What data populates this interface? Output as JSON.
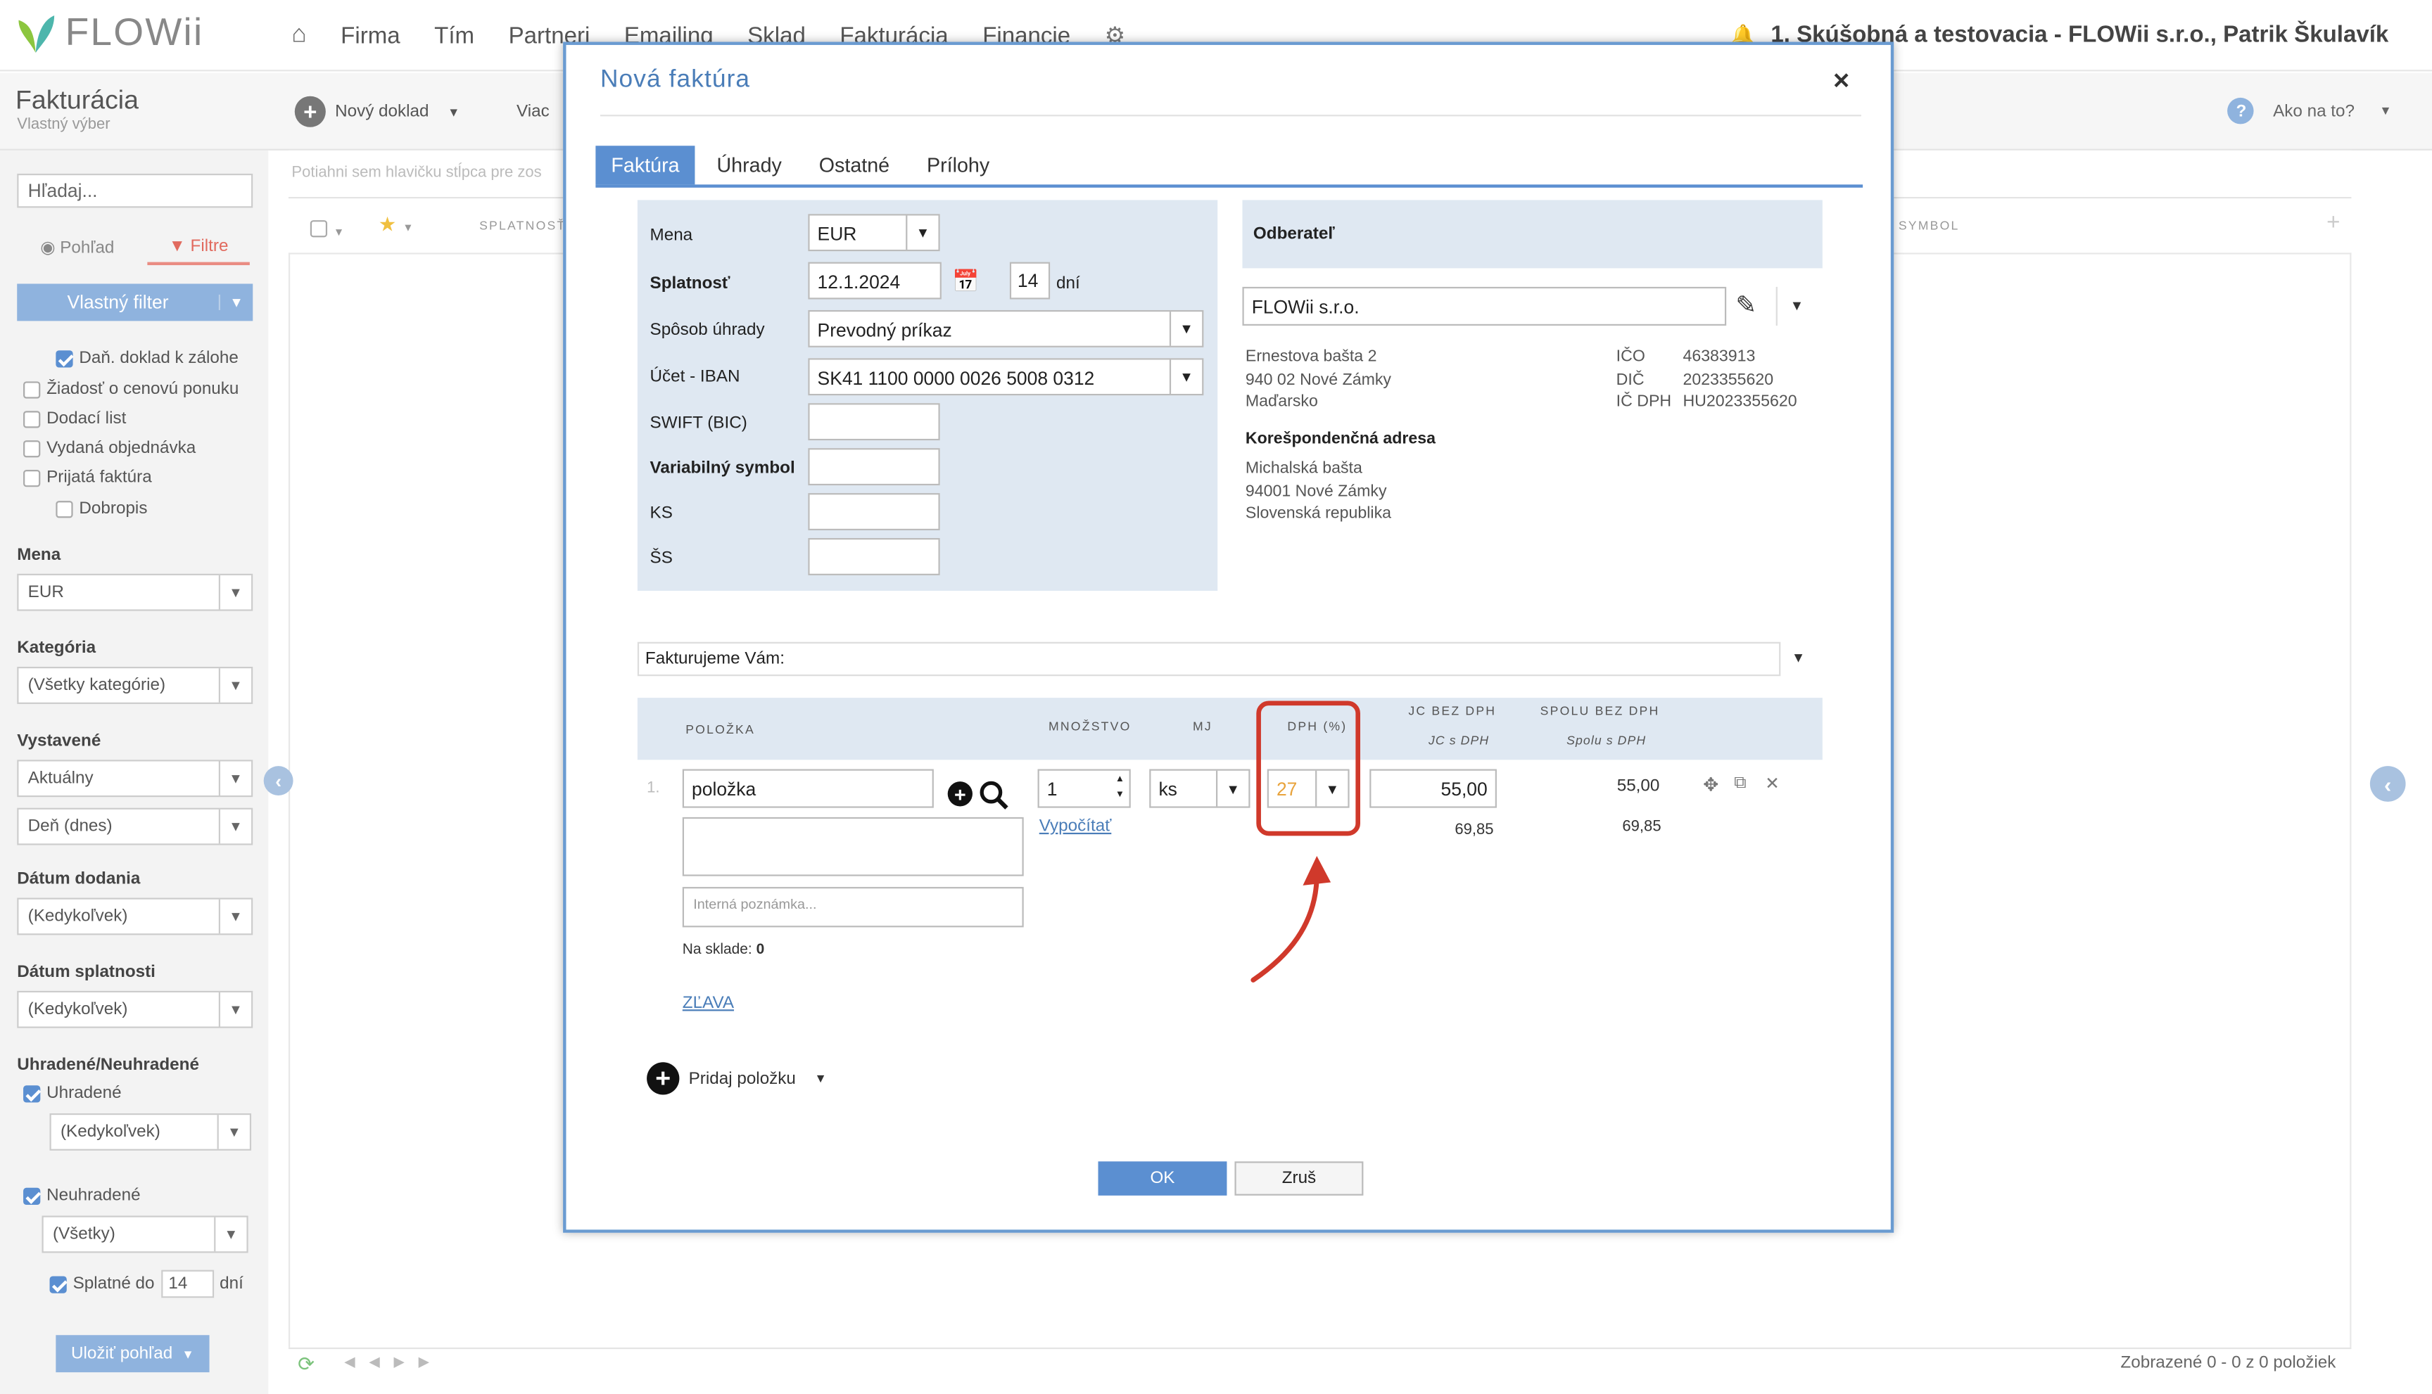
{
  "app": {
    "name": "FLOWii"
  },
  "nav": {
    "items": [
      "Firma",
      "Tím",
      "Partneri",
      "Emailing",
      "Sklad",
      "Fakturácia",
      "Financie"
    ],
    "company": "1. Skúšobná a testovacia - FLOWii s.r.o., Patrik Škulavík"
  },
  "page": {
    "title": "Fakturácia",
    "subtitle": "Vlastný výber",
    "new_doc": "Nový doklad",
    "more": "Viac",
    "help": "Ako na to?",
    "group_hint": "Potiahni sem hlavičku stĺpca pre zos",
    "col_due": "SPLATNOSŤ",
    "col_symbol": "SYMBOL",
    "footer_status": "Zobrazené 0 - 0 z 0 položiek"
  },
  "sidebar": {
    "search_placeholder": "Hľadaj...",
    "view_label": "Pohľad",
    "filter_label": "Filtre",
    "custom_filter": "Vlastný filter",
    "doc_types": [
      {
        "label": "Daň. doklad k zálohe",
        "checked": true
      },
      {
        "label": "Žiadosť o cenovú ponuku",
        "checked": false
      },
      {
        "label": "Dodací list",
        "checked": false
      },
      {
        "label": "Vydaná objednávka",
        "checked": false
      },
      {
        "label": "Prijatá faktúra",
        "checked": false
      },
      {
        "label": "Dobropis",
        "checked": false
      }
    ],
    "currency_label": "Mena",
    "currency_value": "EUR",
    "category_label": "Kategória",
    "category_value": "(Všetky kategórie)",
    "issued_label": "Vystavené",
    "issued_value": "Aktuálny",
    "issued_day": "Deň (dnes)",
    "delivery_label": "Dátum dodania",
    "delivery_value": "(Kedykoľvek)",
    "due_label": "Dátum splatnosti",
    "due_value": "(Kedykoľvek)",
    "paid_label": "Uhradené/Neuhradené",
    "paid": "Uhradené",
    "paid_value": "(Kedykoľvek)",
    "unpaid": "Neuhradené",
    "unpaid_value": "(Všetky)",
    "payable_label": "Splatné do",
    "payable_days": "14",
    "payable_unit": "dní",
    "save_view": "Uložiť pohľad"
  },
  "modal": {
    "title": "Nová faktúra",
    "tabs": [
      "Faktúra",
      "Úhrady",
      "Ostatné",
      "Prílohy"
    ],
    "form": {
      "currency_label": "Mena",
      "currency": "EUR",
      "due_label": "Splatnosť",
      "due_date": "12.1.2024",
      "due_days": "14",
      "due_unit": "dní",
      "payment_label": "Spôsob úhrady",
      "payment": "Prevodný príkaz",
      "iban_label": "Účet - IBAN",
      "iban": "SK41 1100 0000 0026 5008 0312",
      "swift_label": "SWIFT (BIC)",
      "vs_label": "Variabilný symbol",
      "ks_label": "KS",
      "ss_label": "ŠS"
    },
    "customer": {
      "header": "Odberateľ",
      "name": "FLOWii s.r.o.",
      "address": [
        "Ernestova bašta 2",
        "940 02 Nové Zámky",
        "Maďarsko"
      ],
      "ids": [
        {
          "k": "IČO",
          "v": "46383913"
        },
        {
          "k": "DIČ",
          "v": "2023355620"
        },
        {
          "k": "IČ DPH",
          "v": "HU2023355620"
        }
      ],
      "corr_header": "Korešpondenčná adresa",
      "corr_address": [
        "Michalská bašta",
        "94001 Nové Zámky",
        "Slovenská republika"
      ]
    },
    "intro": "Fakturujeme Vám:",
    "items_head": {
      "item": "POLOŽKA",
      "qty": "MNOŽSTVO",
      "unit": "MJ",
      "vat": "DPH (%)",
      "unit_price": "JC BEZ DPH",
      "unit_price_vat": "JC s DPH",
      "total": "SPOLU BEZ DPH",
      "total_vat": "Spolu s DPH"
    },
    "item": {
      "no": "1.",
      "name": "položka",
      "qty": "1",
      "unit": "ks",
      "vat": "27",
      "unit_price": "55,00",
      "unit_price_vat": "69,85",
      "total": "55,00",
      "total_vat": "69,85",
      "calc": "Vypočítať",
      "note_placeholder": "Interná poznámka...",
      "stock_label": "Na sklade:",
      "stock": "0",
      "discount": "ZĽAVA"
    },
    "add_item": "Pridaj položku",
    "ok": "OK",
    "cancel": "Zruš"
  },
  "colors": {
    "accent": "#5b8fd1",
    "highlight": "#d0392b",
    "vat_text": "#e8a33c"
  }
}
